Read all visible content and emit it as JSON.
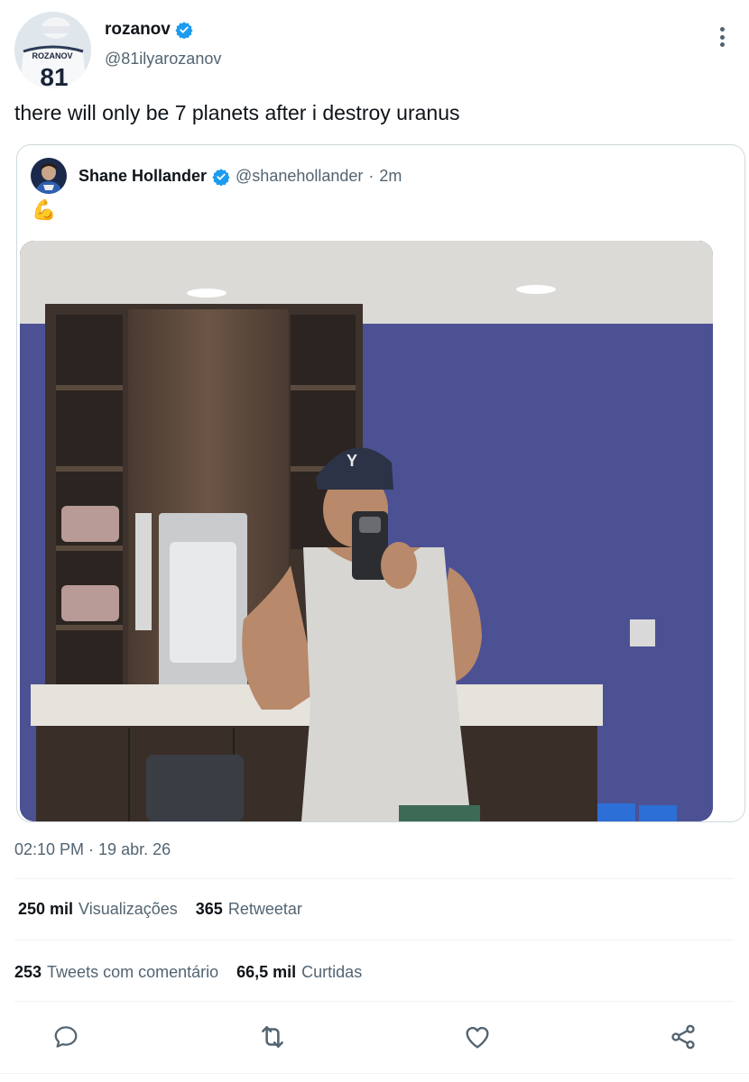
{
  "author": {
    "name": "rozanov",
    "handle": "@81ilyarozanov",
    "jersey_name": "ROZANOV",
    "jersey_number": "81",
    "verified": true
  },
  "tweet": {
    "text": "there will only be 7 planets after i destroy uranus",
    "timestamp": "02:10 PM · 19 abr. 26"
  },
  "quoted_tweet": {
    "name": "Shane Hollander",
    "handle": "@shanehollander",
    "separator": "·",
    "time": "2m",
    "text": "💪",
    "verified": true
  },
  "stats": {
    "views_value": "250 mil",
    "views_label": "Visualizações",
    "retweets_value": "365",
    "retweets_label": "Retweetar",
    "quotes_value": "253",
    "quotes_label": "Tweets com comentário",
    "likes_value": "66,5 mil",
    "likes_label": "Curtidas"
  },
  "actions": [
    "reply-icon",
    "retweet-icon",
    "like-icon",
    "share-icon"
  ],
  "colors": {
    "verified": "#1d9bf0",
    "secondary_text": "#536471",
    "divider": "#eff3f4"
  }
}
